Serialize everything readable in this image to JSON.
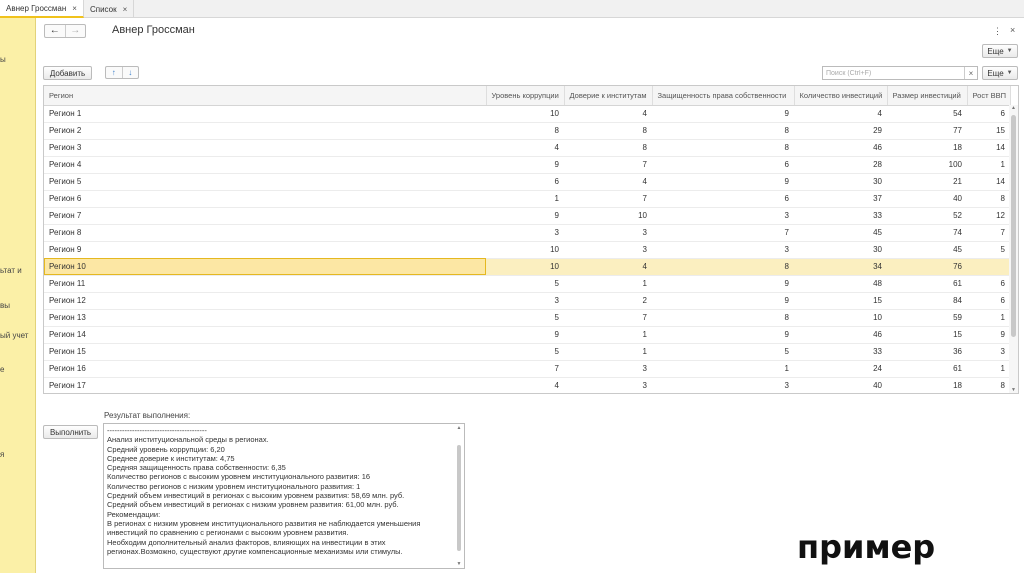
{
  "tabs": [
    {
      "label": "Авнер Гроссман",
      "close": "×"
    },
    {
      "label": "Список",
      "close": "×"
    }
  ],
  "sidebar": {
    "items": [
      {
        "label": "ы"
      },
      {
        "label": "ьтат и"
      },
      {
        "label": "вы"
      },
      {
        "label": "ый учет"
      },
      {
        "label": "е"
      },
      {
        "label": "я"
      }
    ]
  },
  "header": {
    "back": "←",
    "forward": "→",
    "title": "Авнер Гроссман",
    "more": "⋮",
    "close": "×",
    "eshche_top": "Еще"
  },
  "toolbar": {
    "add": "Добавить",
    "move_up": "↑",
    "move_down": "↓",
    "search_placeholder": "Поиск (Ctrl+F)",
    "search_clear": "×",
    "eshche": "Еще"
  },
  "table": {
    "columns": [
      "Регион",
      "Уровень коррупции",
      "Доверие к институтам",
      "Защищенность права собственности",
      "Количество инвестиций",
      "Размер инвестиций",
      "Рост ВВП"
    ],
    "rows": [
      [
        "Регион 1",
        "10",
        "4",
        "9",
        "4",
        "54",
        "6"
      ],
      [
        "Регион 2",
        "8",
        "8",
        "8",
        "29",
        "77",
        "15"
      ],
      [
        "Регион 3",
        "4",
        "8",
        "8",
        "46",
        "18",
        "14"
      ],
      [
        "Регион 4",
        "9",
        "7",
        "6",
        "28",
        "100",
        "1"
      ],
      [
        "Регион 5",
        "6",
        "4",
        "9",
        "30",
        "21",
        "14"
      ],
      [
        "Регион 6",
        "1",
        "7",
        "6",
        "37",
        "40",
        "8"
      ],
      [
        "Регион 7",
        "9",
        "10",
        "3",
        "33",
        "52",
        "12"
      ],
      [
        "Регион 8",
        "3",
        "3",
        "7",
        "45",
        "74",
        "7"
      ],
      [
        "Регион 9",
        "10",
        "3",
        "3",
        "30",
        "45",
        "5"
      ],
      [
        "Регион 10",
        "10",
        "4",
        "8",
        "34",
        "76",
        ""
      ],
      [
        "Регион 11",
        "5",
        "1",
        "9",
        "48",
        "61",
        "6"
      ],
      [
        "Регион 12",
        "3",
        "2",
        "9",
        "15",
        "84",
        "6"
      ],
      [
        "Регион 13",
        "5",
        "7",
        "8",
        "10",
        "59",
        "1"
      ],
      [
        "Регион 14",
        "9",
        "1",
        "9",
        "46",
        "15",
        "9"
      ],
      [
        "Регион 15",
        "5",
        "1",
        "5",
        "33",
        "36",
        "3"
      ],
      [
        "Регион 16",
        "7",
        "3",
        "1",
        "24",
        "61",
        "1"
      ],
      [
        "Регион 17",
        "4",
        "3",
        "3",
        "40",
        "18",
        "8"
      ]
    ],
    "selected_row": 9
  },
  "actions": {
    "execute": "Выполнить"
  },
  "result": {
    "label": "Результат выполнения:",
    "lines": [
      "----------------------------------------",
      "Анализ институциональной среды в регионах.",
      "Средний уровень коррупции: 6,20",
      "Среднее доверие к институтам: 4,75",
      "Средняя защищенность права собственности: 6,35",
      "Количество регионов с высоким уровнем институционального развития: 16",
      "Количество регионов с низким уровнем институционального развития: 1",
      "Средний объем инвестиций в регионах с высоким уровнем развития: 58,69 млн. руб.",
      "Средний объем инвестиций в регионах с низким уровнем развития: 61,00 млн. руб.",
      "Рекомендации:",
      "В регионах с низким уровнем институционального развития не наблюдается уменьшения",
      "инвестиций по сравнению с регионами с высоким уровнем развития.",
      "Необходим дополнительный анализ факторов, влияющих на инвестиции в этих",
      "регионах.Возможно, существуют другие компенсационные механизмы или стимулы."
    ]
  },
  "watermark": "пример"
}
